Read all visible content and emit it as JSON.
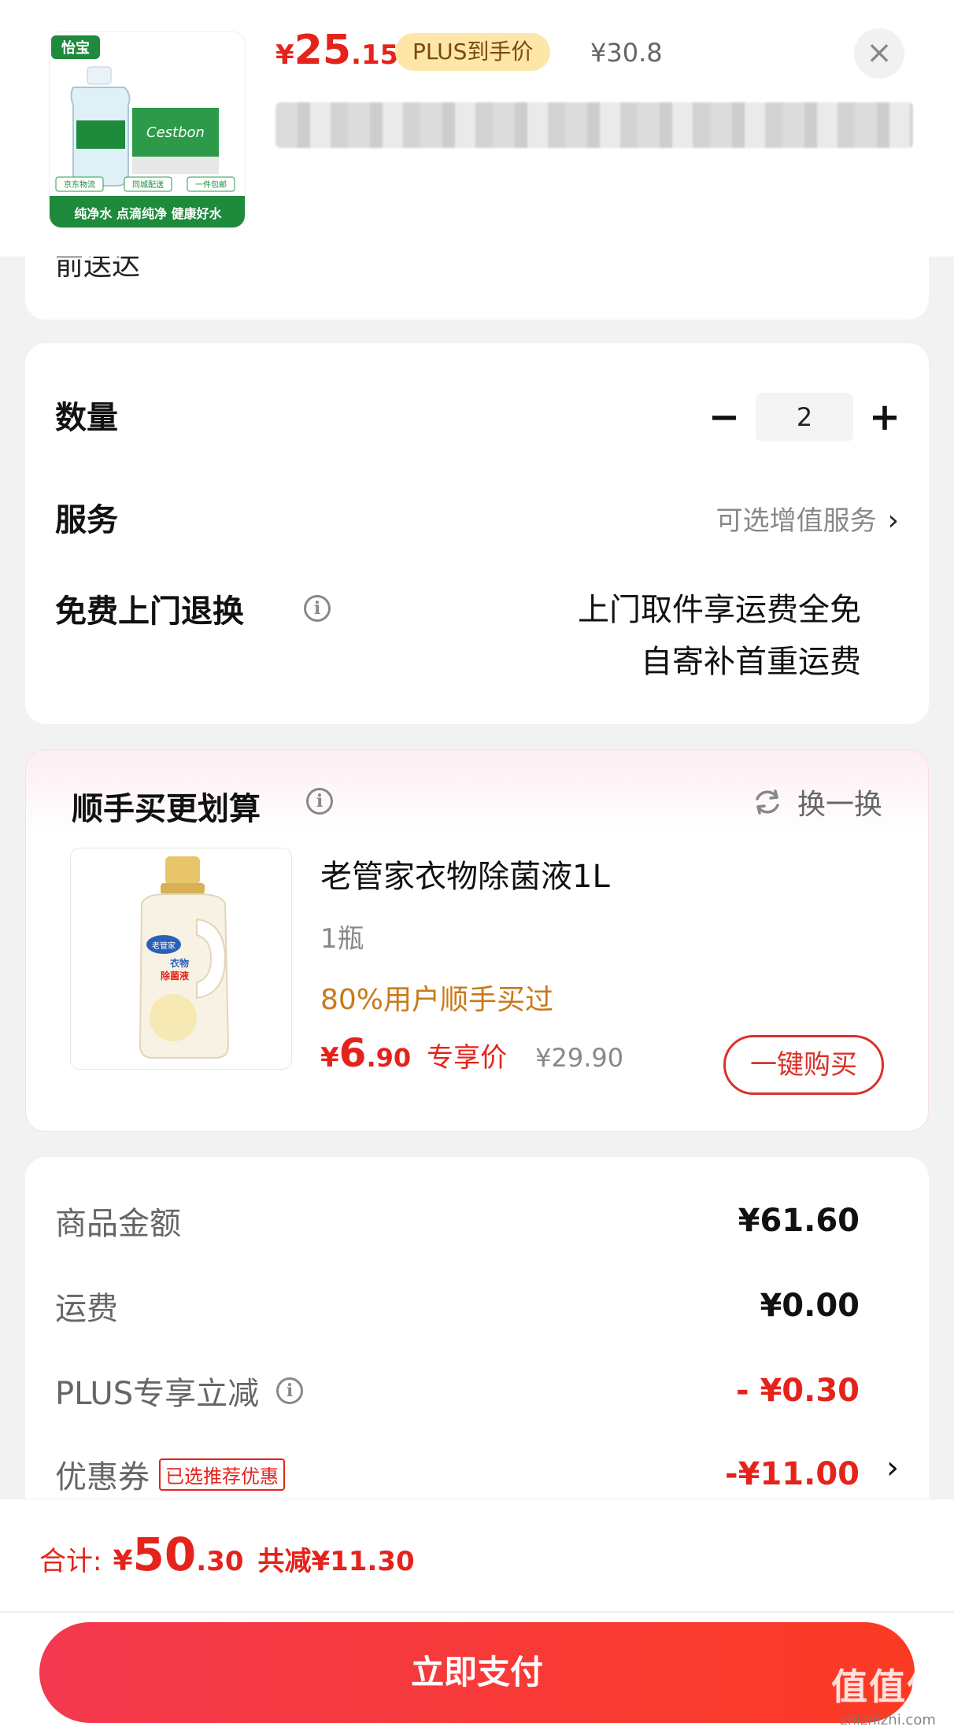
{
  "header": {
    "price_yen": "¥",
    "price_int": "25",
    "price_dec": ".15",
    "plus_badge": "PLUS到手价",
    "original_price": "¥30.8",
    "close_label": "×"
  },
  "product_image": {
    "brand_cn": "怡宝",
    "brand_en": "Cestbon",
    "tags": [
      "京东物流",
      "同城配送",
      "一件包邮"
    ],
    "slogan": "纯净水 点滴纯净 健康好水"
  },
  "delivery": {
    "tail_text": "前送达"
  },
  "quantity": {
    "label": "数量",
    "value": "2",
    "minus": "−",
    "plus": "+"
  },
  "service": {
    "label": "服务",
    "value": "可选增值服务",
    "chevron": "›"
  },
  "free_return": {
    "label": "免费上门退换",
    "info_icon": "i",
    "lines": [
      "上门取件享运费全免",
      "自寄补首重运费"
    ]
  },
  "recommend": {
    "title": "顺手买更划算",
    "info_icon": "i",
    "swap_label": "换一换",
    "item": {
      "name": "老管家衣物除菌液1L",
      "spec": "1瓶",
      "popularity": "80%用户顺手买过",
      "price_yen": "¥",
      "price_int": "6",
      "price_dec": ".90",
      "price_tag": "专享价",
      "original_price": "¥29.90",
      "buy_label": "一键购买",
      "image_brand": "老管家",
      "image_label_1": "衣物",
      "image_label_2": "除菌液"
    }
  },
  "summary": {
    "rows": [
      {
        "label": "商品金额",
        "amount": "¥61.60"
      },
      {
        "label": "运费",
        "amount": "¥0.00"
      },
      {
        "label": "PLUS专享立减",
        "amount": "- ¥0.30"
      },
      {
        "label": "优惠券",
        "tag": "已选推荐优惠",
        "amount": "-¥11.00",
        "chevron": "›"
      }
    ]
  },
  "bottom": {
    "total_label": "合计:",
    "total_yen": "¥",
    "total_int": "50",
    "total_dec": ".30",
    "saved": "共减¥11.30",
    "pay_label": "立即支付",
    "watermark": "值值值",
    "watermark_url": "zhizhizhi.com"
  },
  "colors": {
    "accent_red": "#e5231b",
    "plus_gold": "#fde6a8",
    "popularity_orange": "#c9791a"
  }
}
